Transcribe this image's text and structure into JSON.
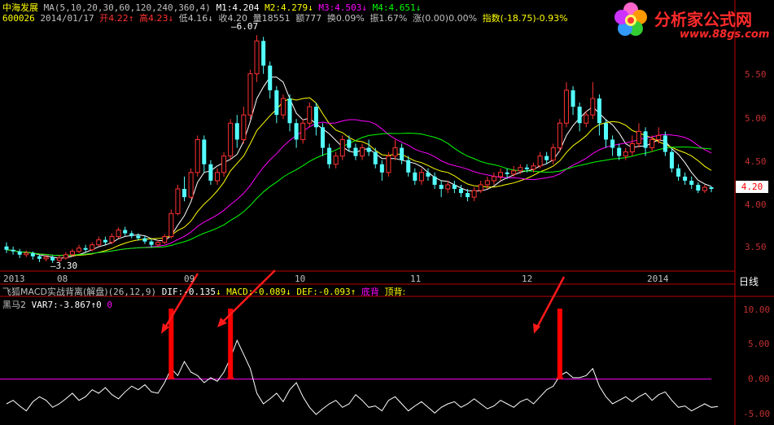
{
  "stock": {
    "name": "中海发展",
    "code": "600026",
    "date": "2014/01/17",
    "ma_label": "MA(5,10,20,30,60,120,240,360,4)",
    "m1": "M1:4.204",
    "m2": "M2:4.279",
    "m3": "M3:4.503",
    "m4": "M4:4.651",
    "open": "开4.22",
    "high": "高4.23",
    "low": "低4.16",
    "close": "收4.20",
    "volume": "量18551",
    "amount": "额777",
    "turnover": "换0.09%",
    "amplitude": "振1.67%",
    "change": "涨(0.00)0.00%",
    "index": "指数(-18.75)-0.93%"
  },
  "logo": {
    "title": "分析家公式网",
    "url": "www.88gs.com"
  },
  "price_panel": {
    "high_label": "6.07",
    "low_label": "3.30",
    "last_price": "4.20",
    "y_ticks": [
      "5.50",
      "5.00",
      "4.50",
      "4.00",
      "3.50"
    ],
    "x_ticks": [
      "2013",
      "08",
      "09",
      "10",
      "11",
      "12",
      "2014"
    ],
    "period": "日线"
  },
  "indicator_panel": {
    "name": "飞狐MACD实战背离(解盘)",
    "params": "(26,12,9)",
    "dif": "DIF:-0.135",
    "macd": "MACD:-0.089",
    "def": "DEF:-0.093",
    "bottom_div": "底背",
    "top_div": "顶背:"
  },
  "heima_panel": {
    "name": "黑马2",
    "var7": "VAR7:-3.867",
    "v0": "0",
    "v1": "0",
    "y_ticks": [
      "10.00",
      "5.00",
      "0.00",
      "-5.00"
    ]
  },
  "colors": {
    "up": "#ff3232",
    "down": "#54ffff",
    "ma5": "#ffffff",
    "ma10": "#ffff00",
    "ma20": "#ff00ff",
    "ma30": "#00ff00",
    "signal": "#ff0000",
    "zero_line": "#ff00ff"
  },
  "chart_data": {
    "type": "candlestick",
    "price_range": [
      3.2,
      6.3
    ],
    "candles": [
      [
        3.5,
        3.46,
        3.55,
        3.42
      ],
      [
        3.46,
        3.44,
        3.5,
        3.4
      ],
      [
        3.44,
        3.4,
        3.47,
        3.36
      ],
      [
        3.4,
        3.42,
        3.45,
        3.37
      ],
      [
        3.42,
        3.38,
        3.44,
        3.34
      ],
      [
        3.38,
        3.35,
        3.4,
        3.31
      ],
      [
        3.35,
        3.37,
        3.4,
        3.32
      ],
      [
        3.37,
        3.33,
        3.39,
        3.3
      ],
      [
        3.33,
        3.36,
        3.39,
        3.31
      ],
      [
        3.36,
        3.4,
        3.43,
        3.34
      ],
      [
        3.4,
        3.44,
        3.47,
        3.38
      ],
      [
        3.44,
        3.48,
        3.52,
        3.42
      ],
      [
        3.48,
        3.46,
        3.52,
        3.43
      ],
      [
        3.46,
        3.52,
        3.55,
        3.44
      ],
      [
        3.52,
        3.58,
        3.62,
        3.5
      ],
      [
        3.58,
        3.55,
        3.62,
        3.52
      ],
      [
        3.55,
        3.62,
        3.66,
        3.53
      ],
      [
        3.62,
        3.7,
        3.73,
        3.6
      ],
      [
        3.7,
        3.66,
        3.74,
        3.63
      ],
      [
        3.66,
        3.63,
        3.69,
        3.6
      ],
      [
        3.63,
        3.6,
        3.66,
        3.57
      ],
      [
        3.6,
        3.56,
        3.63,
        3.53
      ],
      [
        3.56,
        3.52,
        3.59,
        3.49
      ],
      [
        3.52,
        3.55,
        3.58,
        3.5
      ],
      [
        3.55,
        3.62,
        3.65,
        3.53
      ],
      [
        3.62,
        3.9,
        3.95,
        3.6
      ],
      [
        3.9,
        4.2,
        4.25,
        3.88
      ],
      [
        4.2,
        4.1,
        4.35,
        4.05
      ],
      [
        4.1,
        4.4,
        4.45,
        4.08
      ],
      [
        4.4,
        4.8,
        4.85,
        4.35
      ],
      [
        4.8,
        4.5,
        4.85,
        4.4
      ],
      [
        4.5,
        4.3,
        4.55,
        4.25
      ],
      [
        4.3,
        4.4,
        4.45,
        4.25
      ],
      [
        4.4,
        4.6,
        4.65,
        4.35
      ],
      [
        4.6,
        5.0,
        5.05,
        4.55
      ],
      [
        5.0,
        4.8,
        5.1,
        4.7
      ],
      [
        4.8,
        5.1,
        5.2,
        4.75
      ],
      [
        5.1,
        5.6,
        5.65,
        5.05
      ],
      [
        5.6,
        6.0,
        6.07,
        5.5
      ],
      [
        6.0,
        5.7,
        6.05,
        5.6
      ],
      [
        5.7,
        5.4,
        5.75,
        5.3
      ],
      [
        5.4,
        5.1,
        5.45,
        5.0
      ],
      [
        5.1,
        5.3,
        5.35,
        5.05
      ],
      [
        5.3,
        5.0,
        5.35,
        4.9
      ],
      [
        5.0,
        4.8,
        5.05,
        4.7
      ],
      [
        4.8,
        5.0,
        5.05,
        4.75
      ],
      [
        5.0,
        5.2,
        5.25,
        4.95
      ],
      [
        5.2,
        4.95,
        5.25,
        4.85
      ],
      [
        4.95,
        4.7,
        5.0,
        4.6
      ],
      [
        4.7,
        4.5,
        4.75,
        4.45
      ],
      [
        4.5,
        4.6,
        4.65,
        4.45
      ],
      [
        4.6,
        4.8,
        4.85,
        4.55
      ],
      [
        4.8,
        4.7,
        4.85,
        4.65
      ],
      [
        4.7,
        4.6,
        4.75,
        4.55
      ],
      [
        4.6,
        4.7,
        4.75,
        4.55
      ],
      [
        4.7,
        4.65,
        4.8,
        4.6
      ],
      [
        4.65,
        4.5,
        4.7,
        4.45
      ],
      [
        4.5,
        4.4,
        4.55,
        4.3
      ],
      [
        4.4,
        4.6,
        4.65,
        4.35
      ],
      [
        4.6,
        4.7,
        4.8,
        4.55
      ],
      [
        4.7,
        4.55,
        4.75,
        4.5
      ],
      [
        4.55,
        4.4,
        4.6,
        4.35
      ],
      [
        4.4,
        4.3,
        4.45,
        4.25
      ],
      [
        4.3,
        4.4,
        4.45,
        4.25
      ],
      [
        4.4,
        4.35,
        4.45,
        4.3
      ],
      [
        4.35,
        4.25,
        4.4,
        4.2
      ],
      [
        4.25,
        4.2,
        4.3,
        4.1
      ],
      [
        4.2,
        4.25,
        4.3,
        4.15
      ],
      [
        4.25,
        4.2,
        4.3,
        4.15
      ],
      [
        4.2,
        4.15,
        4.25,
        4.1
      ],
      [
        4.15,
        4.1,
        4.2,
        4.05
      ],
      [
        4.1,
        4.18,
        4.22,
        4.05
      ],
      [
        4.18,
        4.25,
        4.3,
        4.15
      ],
      [
        4.25,
        4.3,
        4.35,
        4.2
      ],
      [
        4.3,
        4.35,
        4.4,
        4.25
      ],
      [
        4.35,
        4.4,
        4.45,
        4.3
      ],
      [
        4.4,
        4.38,
        4.45,
        4.32
      ],
      [
        4.38,
        4.42,
        4.48,
        4.35
      ],
      [
        4.42,
        4.46,
        4.5,
        4.38
      ],
      [
        4.46,
        4.44,
        4.5,
        4.4
      ],
      [
        4.44,
        4.48,
        4.52,
        4.4
      ],
      [
        4.48,
        4.6,
        4.65,
        4.45
      ],
      [
        4.6,
        4.55,
        4.65,
        4.5
      ],
      [
        4.55,
        4.7,
        4.75,
        4.5
      ],
      [
        4.7,
        5.0,
        5.05,
        4.65
      ],
      [
        5.0,
        5.4,
        5.5,
        4.95
      ],
      [
        5.4,
        5.2,
        5.45,
        5.1
      ],
      [
        5.2,
        5.0,
        5.25,
        4.9
      ],
      [
        5.0,
        5.1,
        5.15,
        4.95
      ],
      [
        5.1,
        5.3,
        5.5,
        5.05
      ],
      [
        5.3,
        5.0,
        5.35,
        4.85
      ],
      [
        5.0,
        4.8,
        5.05,
        4.7
      ],
      [
        4.8,
        4.7,
        4.85,
        4.6
      ],
      [
        4.7,
        4.6,
        4.75,
        4.55
      ],
      [
        4.6,
        4.65,
        4.7,
        4.55
      ],
      [
        4.65,
        4.75,
        4.85,
        4.6
      ],
      [
        4.75,
        4.9,
        5.0,
        4.7
      ],
      [
        4.9,
        4.7,
        4.95,
        4.6
      ],
      [
        4.7,
        4.8,
        4.85,
        4.65
      ],
      [
        4.8,
        4.85,
        4.95,
        4.75
      ],
      [
        4.85,
        4.65,
        4.9,
        4.6
      ],
      [
        4.65,
        4.45,
        4.7,
        4.4
      ],
      [
        4.45,
        4.35,
        4.5,
        4.3
      ],
      [
        4.35,
        4.3,
        4.4,
        4.25
      ],
      [
        4.3,
        4.25,
        4.35,
        4.2
      ],
      [
        4.25,
        4.18,
        4.28,
        4.15
      ],
      [
        4.18,
        4.22,
        4.25,
        4.15
      ],
      [
        4.22,
        4.2,
        4.23,
        4.16
      ]
    ],
    "var7": [
      -3.5,
      -3.0,
      -3.8,
      -4.5,
      -3.2,
      -2.5,
      -3.0,
      -4.0,
      -3.5,
      -2.8,
      -2.0,
      -3.0,
      -2.5,
      -1.5,
      -2.0,
      -1.2,
      -2.2,
      -2.8,
      -1.8,
      -1.0,
      -1.5,
      -0.8,
      -1.8,
      -2.0,
      -0.5,
      1.5,
      0.5,
      2.5,
      1.0,
      0.5,
      -0.5,
      0.2,
      -0.3,
      1.0,
      3.0,
      5.5,
      3.5,
      1.5,
      -2.0,
      -3.5,
      -2.8,
      -2.0,
      -3.2,
      -1.5,
      -0.5,
      -2.5,
      -4.0,
      -5.0,
      -4.2,
      -3.5,
      -3.0,
      -4.0,
      -3.5,
      -2.2,
      -3.0,
      -4.0,
      -3.8,
      -4.5,
      -3.0,
      -2.5,
      -3.5,
      -4.5,
      -3.8,
      -3.2,
      -4.0,
      -4.8,
      -4.0,
      -3.5,
      -3.2,
      -4.0,
      -3.5,
      -2.8,
      -3.5,
      -4.2,
      -3.8,
      -3.0,
      -3.5,
      -4.0,
      -3.2,
      -2.8,
      -3.5,
      -2.5,
      -1.5,
      -1.0,
      0.5,
      1.0,
      0.2,
      0.2,
      0.5,
      1.5,
      -1.0,
      -2.5,
      -3.5,
      -3.0,
      -2.5,
      -3.2,
      -2.5,
      -2.0,
      -3.0,
      -2.2,
      -1.8,
      -3.0,
      -4.0,
      -3.8,
      -4.5,
      -4.0,
      -3.5,
      -4.0,
      -3.867
    ],
    "signals": [
      25,
      34,
      84
    ],
    "var7_range": [
      -6.5,
      11.5
    ]
  }
}
